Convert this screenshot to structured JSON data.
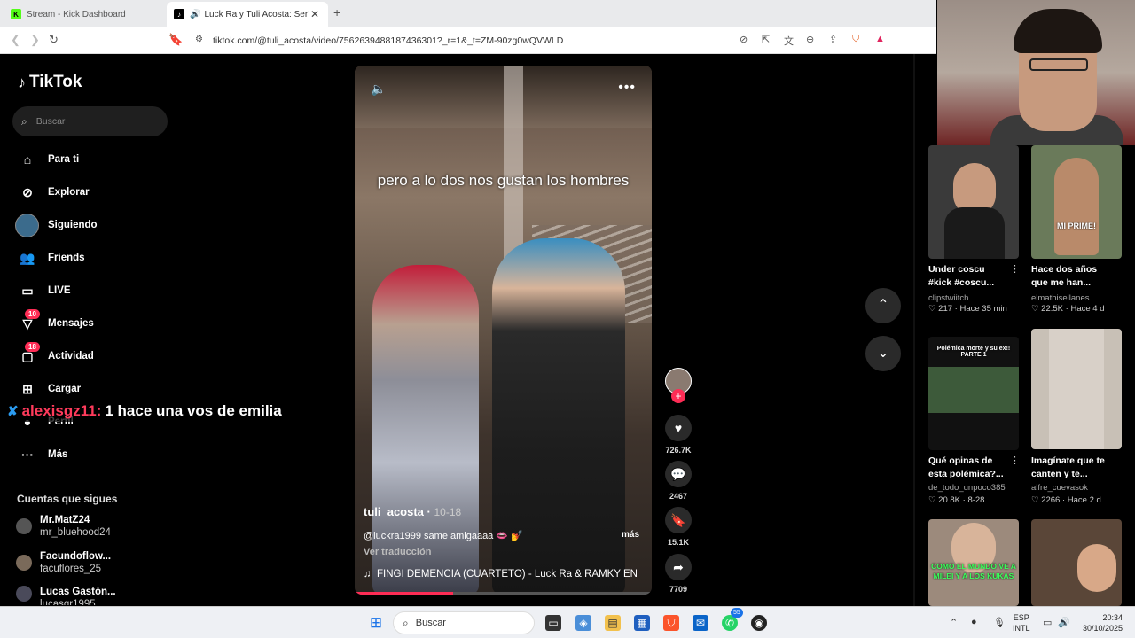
{
  "browser": {
    "tabs": [
      {
        "title": "Stream - Kick Dashboard",
        "favicon": "K",
        "favicon_color": "#53fc18"
      },
      {
        "title": "Luck Ra y Tuli Acosta: Seríamos",
        "favicon": "♪",
        "favicon_color": "#000000"
      }
    ],
    "url": "tiktok.com/@tuli_acosta/video/7562639488187436301?_r=1&_t=ZM-90zg0wQVWLD"
  },
  "tiktok": {
    "logo": "TikTok",
    "search_placeholder": "Buscar",
    "nav": [
      {
        "label": "Para ti",
        "icon": "home-icon"
      },
      {
        "label": "Explorar",
        "icon": "compass-icon"
      },
      {
        "label": "Siguiendo",
        "icon": "following-avatar-icon"
      },
      {
        "label": "Friends",
        "icon": "friends-icon"
      },
      {
        "label": "LIVE",
        "icon": "live-icon"
      },
      {
        "label": "Mensajes",
        "icon": "messages-icon",
        "badge": "10"
      },
      {
        "label": "Actividad",
        "icon": "activity-icon",
        "badge": "18"
      },
      {
        "label": "Cargar",
        "icon": "upload-icon"
      },
      {
        "label": "Perfil",
        "icon": "profile-icon"
      },
      {
        "label": "Más",
        "icon": "more-icon"
      }
    ],
    "following_title": "Cuentas que sigues",
    "following": [
      {
        "name": "Mr.MatZ24",
        "handle": "mr_bluehood24"
      },
      {
        "name": "Facundoflow...",
        "handle": "facuflores_25"
      },
      {
        "name": "Lucas Gastón...",
        "handle": "lucasgr1995"
      }
    ]
  },
  "chat_overlay": {
    "user": "alexisgz11:",
    "message": "1 hace una vos de emilia"
  },
  "video": {
    "caption": "pero a lo dos nos gustan los hombres",
    "author": "tuli_acosta",
    "date": "10-18",
    "description": "@luckra1999 same amigaaaa 👄 💅",
    "more": "más",
    "translate": "Ver traducción",
    "music": "FINGI DEMENCIA (CUARTETO) - Luck Ra & RAMKY EN",
    "progress": 0.33,
    "likes": "726.7K",
    "comments": "2467",
    "saves": "15.1K",
    "shares": "7709"
  },
  "related": [
    {
      "title": "Under coscu #kick #coscu...",
      "author": "clipstwiitch",
      "likes": "217",
      "time": "Hace 35 min",
      "overlay": "MI PRIME!",
      "bg": "#3a3a3a"
    },
    {
      "title": "Hace dos años que me han...",
      "author": "elmathisellanes",
      "likes": "22.5K",
      "time": "Hace 4 d",
      "overlay": "",
      "bg": "#6a7a5a"
    },
    {
      "title": "Qué opinas de esta polémica?...",
      "author": "de_todo_unpoco385",
      "likes": "20.8K",
      "time": "8-28",
      "overlay": "Polémica morte y su ex!! PARTE 1",
      "bg": "#111111"
    },
    {
      "title": "Imagínate que te canten y te...",
      "author": "alfre_cuevasok",
      "likes": "2266",
      "time": "Hace 2 d",
      "overlay": "",
      "bg": "#c8c0b6"
    },
    {
      "title": "",
      "author": "",
      "likes": "",
      "time": "",
      "overlay": "COMO EL MUNDO VE A MILEI Y A LOS KUKAS",
      "bg": "#9c8a7c"
    },
    {
      "title": "",
      "author": "",
      "likes": "",
      "time": "",
      "overlay": "",
      "bg": "#5a4638"
    }
  ],
  "taskbar": {
    "search_placeholder": "Buscar",
    "lang": "ESP",
    "layout": "INTL",
    "time": "20:34",
    "date": "30/10/2025",
    "whatsapp_badge": "55"
  }
}
